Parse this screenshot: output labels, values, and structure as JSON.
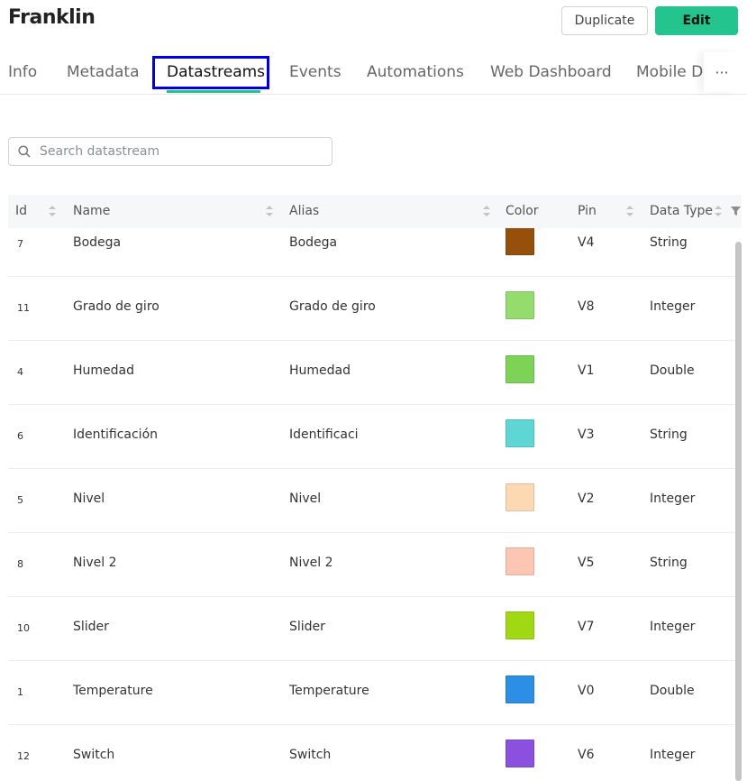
{
  "header": {
    "title": "Franklin",
    "duplicate_label": "Duplicate",
    "edit_label": "Edit",
    "edit_color": "#23c48e"
  },
  "tabs": [
    {
      "label": "Info",
      "active": false
    },
    {
      "label": "Metadata",
      "active": false
    },
    {
      "label": "Datastreams",
      "active": true
    },
    {
      "label": "Events",
      "active": false
    },
    {
      "label": "Automations",
      "active": false
    },
    {
      "label": "Web Dashboard",
      "active": false
    },
    {
      "label": "Mobile D",
      "active": false
    }
  ],
  "more_label": "···",
  "search": {
    "placeholder": "Search datastream",
    "value": ""
  },
  "table": {
    "columns": [
      "Id",
      "Name",
      "Alias",
      "Color",
      "Pin",
      "Data Type"
    ],
    "rows": [
      {
        "id": "7",
        "name": "Bodega",
        "alias": "Bodega",
        "color": "#96500b",
        "pin": "V4",
        "type": "String"
      },
      {
        "id": "11",
        "name": "Grado de giro",
        "alias": "Grado de giro",
        "color": "#94dc6e",
        "pin": "V8",
        "type": "Integer"
      },
      {
        "id": "4",
        "name": "Humedad",
        "alias": "Humedad",
        "color": "#7cd356",
        "pin": "V1",
        "type": "Double"
      },
      {
        "id": "6",
        "name": "Identificación",
        "alias": "Identificaci",
        "color": "#5fd6d6",
        "pin": "V3",
        "type": "String"
      },
      {
        "id": "5",
        "name": "Nivel",
        "alias": "Nivel",
        "color": "#fcd9b3",
        "pin": "V2",
        "type": "Integer"
      },
      {
        "id": "8",
        "name": "Nivel 2",
        "alias": "Nivel 2",
        "color": "#fcc6b2",
        "pin": "V5",
        "type": "String"
      },
      {
        "id": "10",
        "name": "Slider",
        "alias": "Slider",
        "color": "#a1d814",
        "pin": "V7",
        "type": "Integer"
      },
      {
        "id": "1",
        "name": "Temperature",
        "alias": "Temperature",
        "color": "#2d8ee5",
        "pin": "V0",
        "type": "Double"
      },
      {
        "id": "12",
        "name": "Switch",
        "alias": "Switch",
        "color": "#8b50de",
        "pin": "V6",
        "type": "Integer"
      }
    ]
  }
}
